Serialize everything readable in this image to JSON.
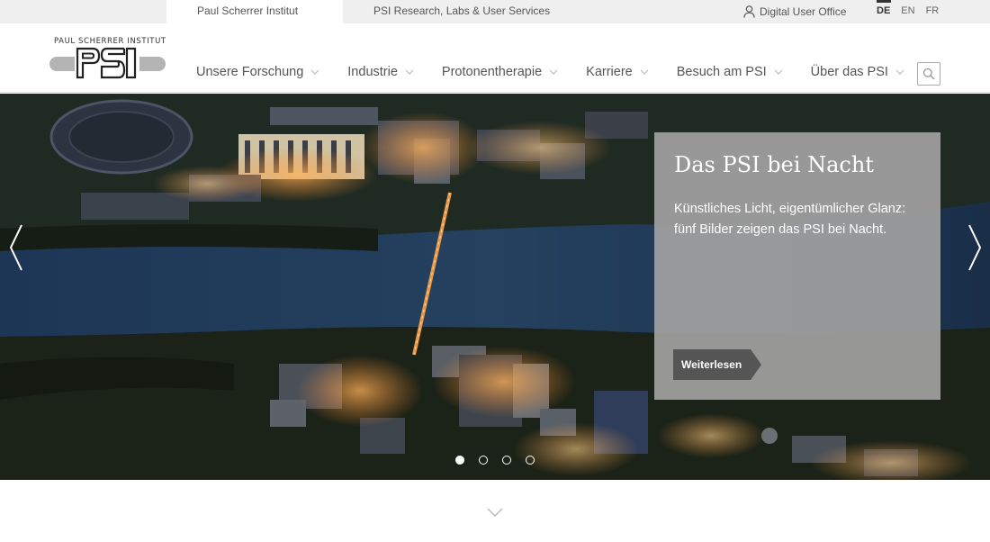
{
  "topbar": {
    "tabs": [
      {
        "label": "Paul Scherrer Institut PSI"
      },
      {
        "label": "PSI Research, Labs & User Services"
      }
    ],
    "digital_user_office": "Digital User Office",
    "languages": [
      "DE",
      "EN",
      "FR"
    ],
    "active_language": "DE"
  },
  "logo": {
    "institute_name": "PAUL SCHERRER INSTITUT",
    "mark": "PSI"
  },
  "nav": {
    "items": [
      {
        "label": "Unsere Forschung"
      },
      {
        "label": "Industrie"
      },
      {
        "label": "Protonentherapie"
      },
      {
        "label": "Karriere"
      },
      {
        "label": "Besuch am PSI"
      },
      {
        "label": "Über das PSI"
      }
    ]
  },
  "hero": {
    "title": "Das PSI bei Nacht",
    "text": "Künstliches Licht, eigentümlicher Glanz: fünf Bilder zeigen das PSI bei Nacht.",
    "button": "Weiterlesen",
    "slides_total": 4,
    "active_slide": 1
  },
  "icons": {
    "user": "user-icon",
    "search": "search-icon",
    "prev": "chevron-left-icon",
    "next": "chevron-right-icon",
    "scroll": "chevron-down-icon"
  }
}
